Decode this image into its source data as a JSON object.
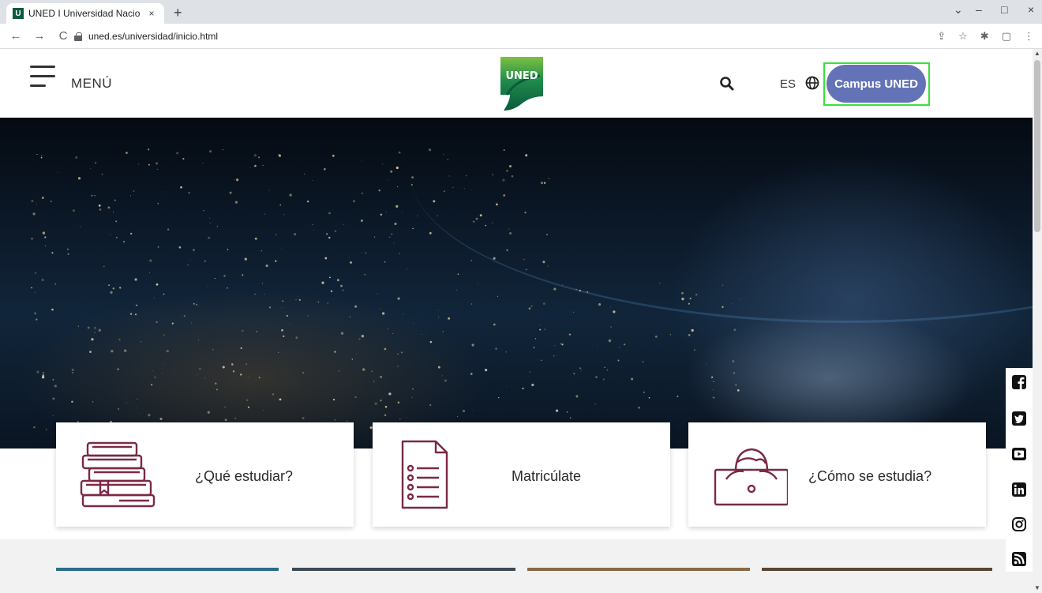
{
  "browser": {
    "tab_title": "UNED I Universidad Nacio",
    "tab_favicon_letter": "U",
    "tab_close": "×",
    "new_tab": "+",
    "url": "uned.es/universidad/inicio.html",
    "back": "←",
    "forward": "→",
    "reload": "C",
    "window_min": "–",
    "window_max": "□",
    "window_close": "×",
    "window_chevron": "⌄"
  },
  "header": {
    "menu_label": "MENÚ",
    "logo_text": "UNED",
    "language": "ES",
    "campus_button": "Campus UNED"
  },
  "cards": [
    {
      "label": "¿Qué estudiar?",
      "icon": "books-icon"
    },
    {
      "label": "Matricúlate",
      "icon": "document-list-icon"
    },
    {
      "label": "¿Cómo se estudia?",
      "icon": "student-laptop-icon"
    }
  ],
  "social": [
    "facebook-icon",
    "twitter-icon",
    "youtube-icon",
    "linkedin-icon",
    "instagram-icon",
    "rss-icon"
  ],
  "colors": {
    "accent": "#6473b8",
    "brand_green": "#0b5a3d",
    "icon_maroon": "#7a2946",
    "highlight": "#39e13a"
  }
}
